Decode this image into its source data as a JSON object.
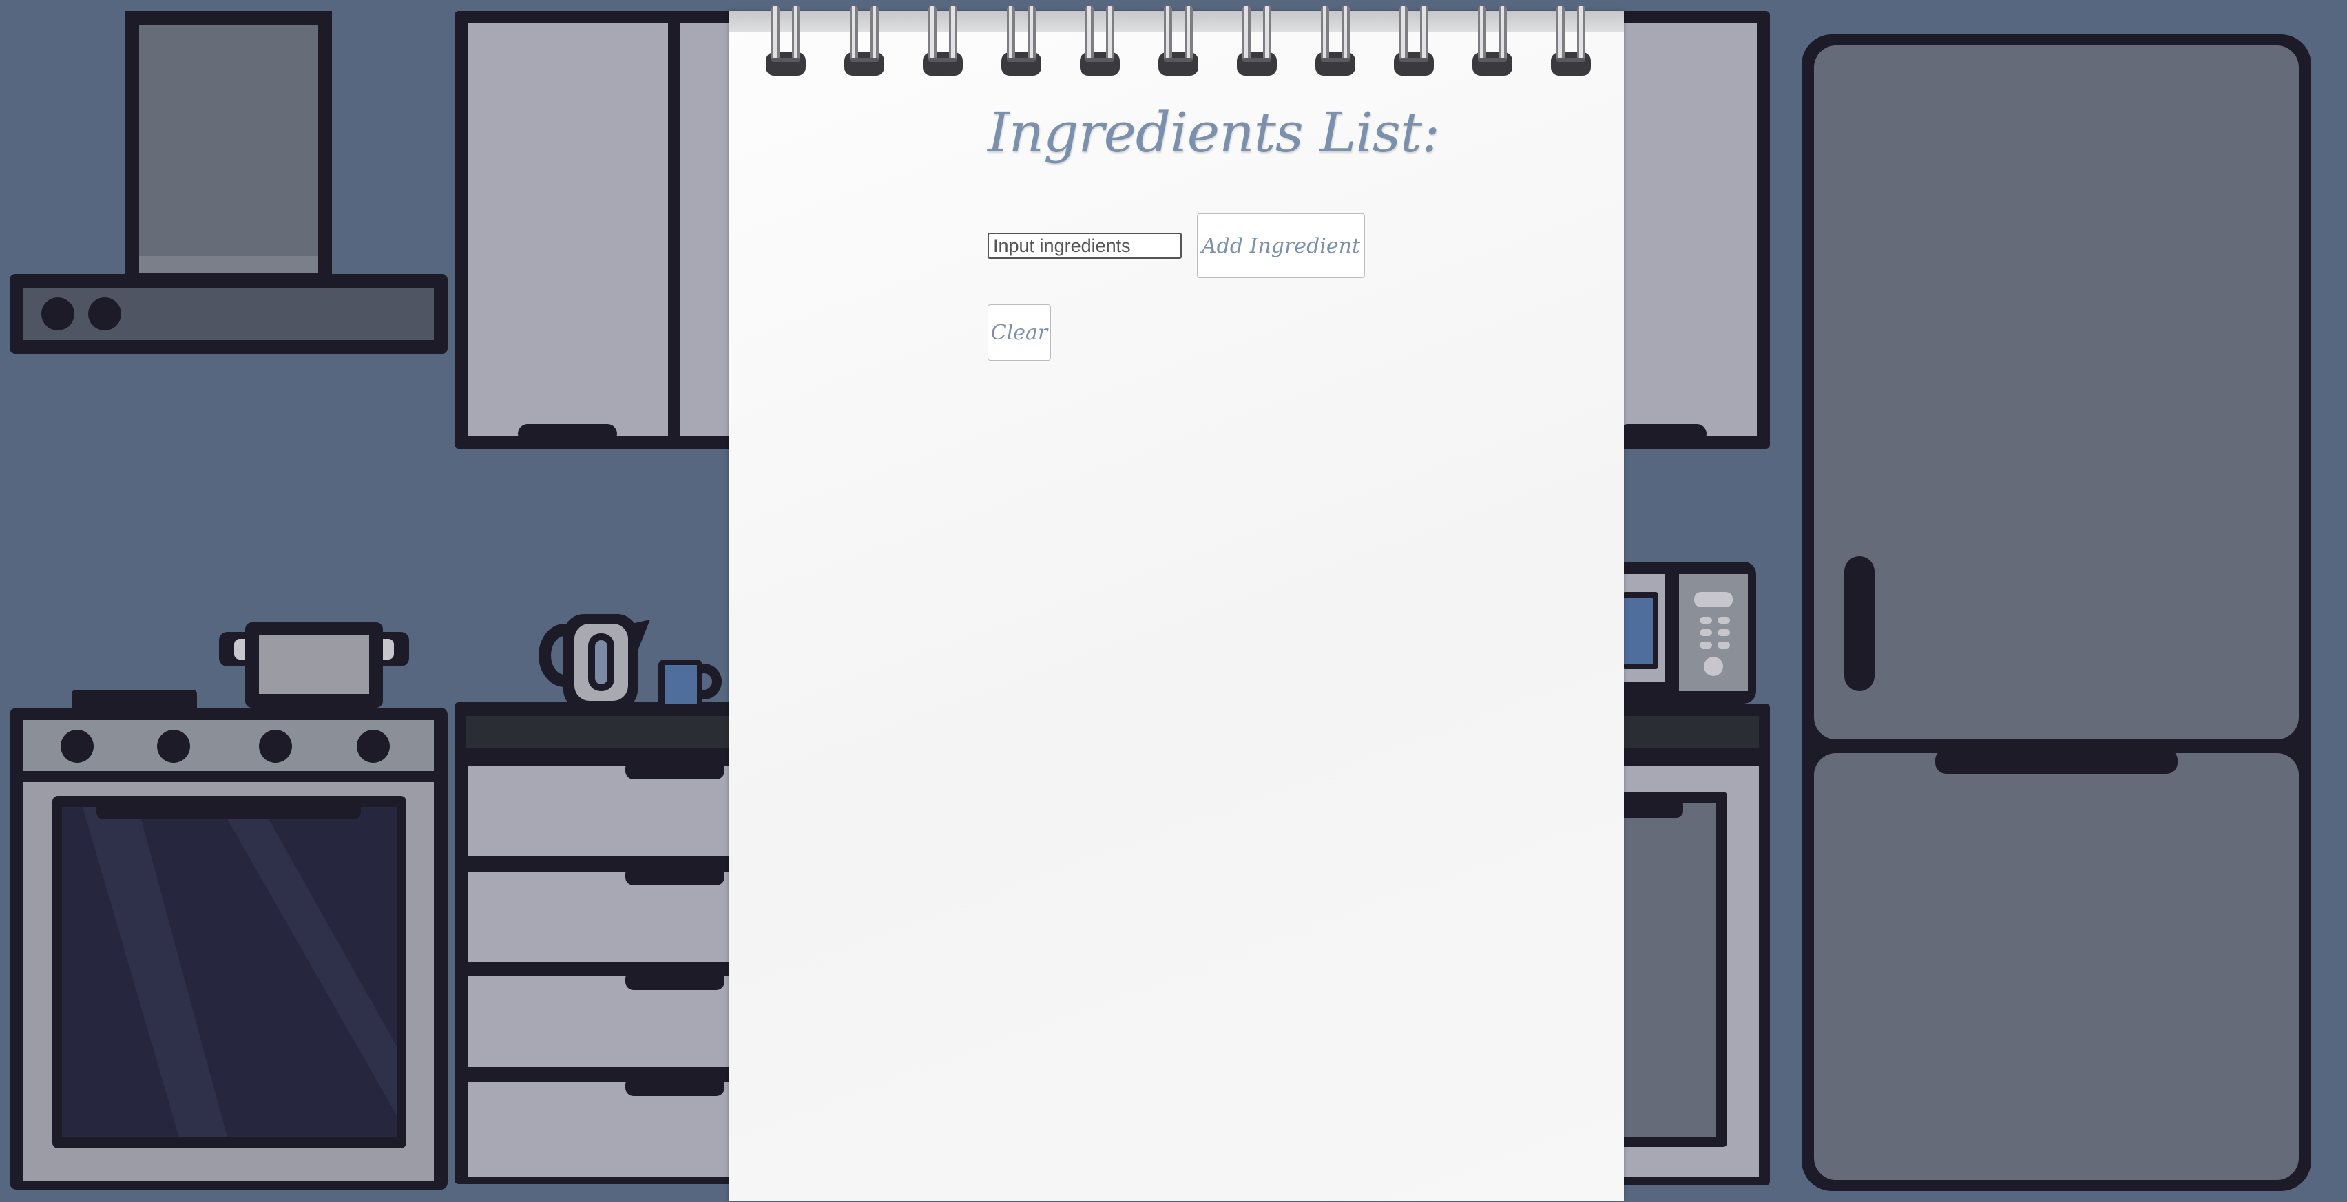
{
  "notepad": {
    "title": "Ingredients List:",
    "input": {
      "value": "",
      "placeholder": "Input ingredients"
    },
    "add_button_label": "Add Ingredient",
    "clear_button_label": "Clear",
    "ring_count": 11
  },
  "colors": {
    "wall": "#56677f",
    "outline": "#1c1b27",
    "cabinet": "#a8a8b4",
    "fridge": "#656b78",
    "oven_window": "#26273f",
    "notepad_text": "#7b90ad"
  },
  "icons": [
    "range-hood-icon",
    "cabinet-icon",
    "oven-icon",
    "pot-icon",
    "kettle-icon",
    "mug-icon",
    "drawer-icon",
    "microwave-icon",
    "fridge-icon",
    "spiral-ring-icon"
  ]
}
